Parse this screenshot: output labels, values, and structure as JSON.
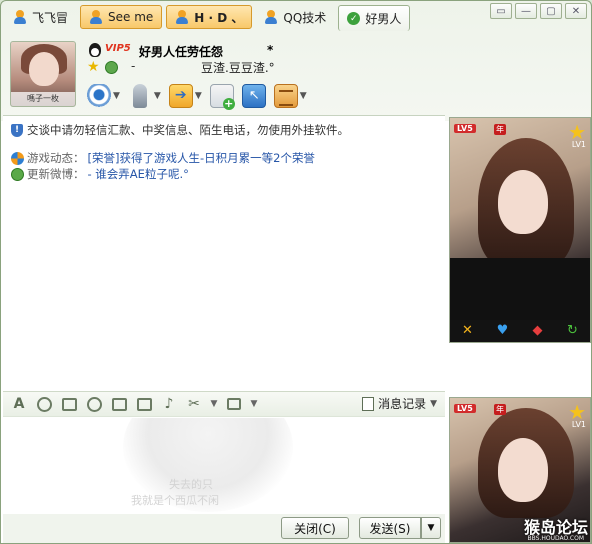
{
  "tabs": [
    {
      "label": "飞飞冒",
      "style": "plain"
    },
    {
      "label": "See me",
      "style": "orange"
    },
    {
      "label": "H · D 、",
      "style": "orange"
    },
    {
      "label": "QQ技术",
      "style": "plain"
    },
    {
      "label": "好男人",
      "style": "active"
    }
  ],
  "window_controls": [
    "▭",
    "—",
    "▢",
    "✕"
  ],
  "profile": {
    "avatar_caption": "嗎子一枚",
    "vip": "VIP5",
    "name": "好男人任劳任怨",
    "name_mark": "*",
    "signature_prefix": "-",
    "signature": "豆渣.豆豆渣.°"
  },
  "toolbar": {
    "icons": [
      "camera-icon",
      "microphone-icon",
      "file-transfer-icon",
      "group-chat-icon",
      "remote-assist-icon",
      "app-icon"
    ]
  },
  "chat": {
    "notice": "交谈中请勿轻信汇款、中奖信息、陌生电话，勿使用外挂软件。",
    "game_label": "游戏动态：",
    "game_value": "[荣誉]获得了游戏人生-日积月累一等2个荣誉",
    "weibo_label": "更新微博：",
    "weibo_value": "-            谁会弄AE粒子呢.°"
  },
  "input_toolbar": {
    "message_log": "消息记录"
  },
  "input_area": {
    "watermark_line1": "失去的只",
    "watermark_line2": "我就是个西瓜不闲"
  },
  "buttons": {
    "close": "关闭(C)",
    "send": "发送(S)"
  },
  "video": {
    "lv_badge": "LV5",
    "year_badge": "年",
    "lv1": "LV1",
    "site_mark": "猴岛论坛",
    "site_url": "BBS.HOUDAO.COM"
  },
  "colors": {
    "accent_orange": "#f8c86a",
    "link_blue": "#2756a8",
    "frame_green": "#8aa27d"
  }
}
